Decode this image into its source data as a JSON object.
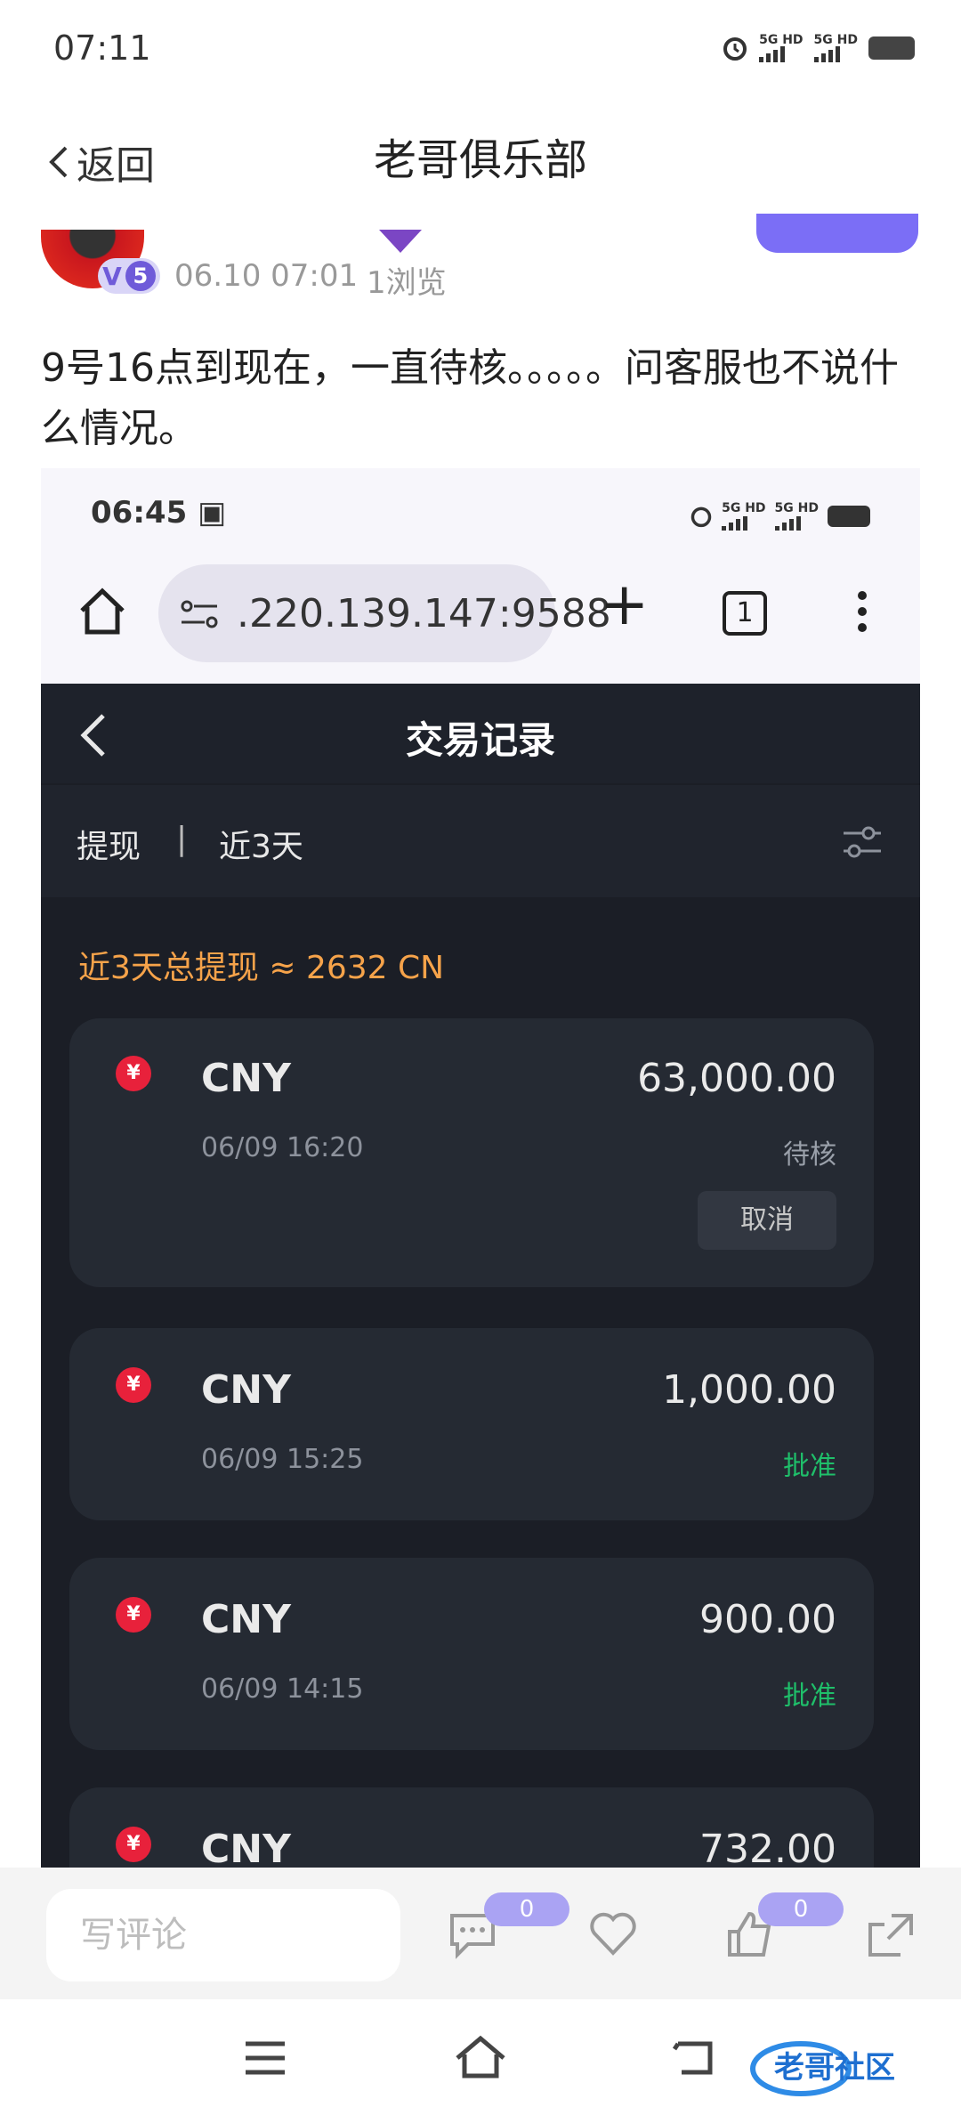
{
  "status_bar": {
    "time": "07:11",
    "net1": "5G HD",
    "net2": "5G HD"
  },
  "header": {
    "back_label": "返回",
    "title": "老哥俱乐部"
  },
  "author": {
    "level": "V",
    "level_num": "5",
    "date": "06.10 07:01",
    "views": "1浏览"
  },
  "post": {
    "text": "9号16点到现在，一直待核。。。。。问客服也不说什么情况。"
  },
  "screenshot": {
    "status_time": "06:45",
    "net1": "5G HD",
    "net2": "5G HD",
    "url": ".220.139.147:9588",
    "tab_count": "1",
    "page_title": "交易记录",
    "filter_type": "提现",
    "filter_sep": "|",
    "filter_range": "近3天",
    "summary": "近3天总提现 ≈ 2632 CN",
    "records": [
      {
        "currency": "CNY",
        "amount": "63,000.00",
        "time": "06/09 16:20",
        "status": "待核",
        "status_color": "#9aa0aa",
        "action": "取消"
      },
      {
        "currency": "CNY",
        "amount": "1,000.00",
        "time": "06/09 15:25",
        "status": "批准",
        "status_color": "#1fbf6a"
      },
      {
        "currency": "CNY",
        "amount": "900.00",
        "time": "06/09 14:15",
        "status": "批准",
        "status_color": "#1fbf6a"
      },
      {
        "currency": "CNY",
        "amount": "732.00"
      }
    ],
    "yen_symbol": "¥"
  },
  "comment_bar": {
    "placeholder": "写评论",
    "comment_count": "0",
    "like_count": "0"
  },
  "colors": {
    "accent": "#7b6ef6",
    "summary": "#f6a34a",
    "approved": "#1fbf6a",
    "dark_bg": "#1b1e26"
  }
}
